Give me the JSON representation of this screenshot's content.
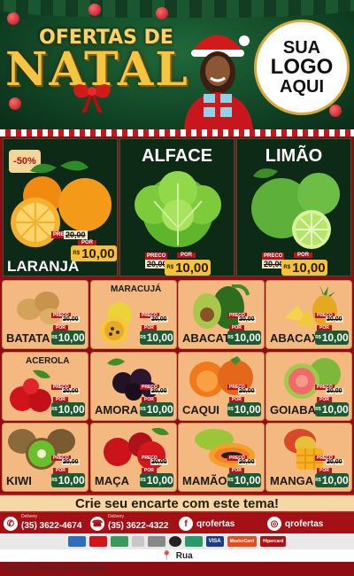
{
  "header": {
    "title_top": "OFERTAS DE",
    "title_main": "NATAL",
    "logo_line1": "SUA",
    "logo_line2": "LOGO",
    "logo_line3": "AQUI"
  },
  "featured": [
    {
      "name": "LARANJA",
      "badge": "-50%",
      "preco_label": "PRECO",
      "old_price": "20,00",
      "por_label": "POR",
      "currency": "R$",
      "new_price": "10,00"
    },
    {
      "name": "ALFACE",
      "preco_label": "PRECO",
      "old_price": "20,00",
      "por_label": "POR",
      "currency": "R$",
      "new_price": "10,00"
    },
    {
      "name": "LIMÃO",
      "preco_label": "PRECO",
      "old_price": "20,00",
      "por_label": "POR",
      "currency": "R$",
      "new_price": "10,00"
    }
  ],
  "products": [
    {
      "name": "BATATA",
      "old_price": "20,00",
      "new_price": "10,00"
    },
    {
      "name": "MARACUJÁ",
      "old_price": "20,00",
      "new_price": "10,00"
    },
    {
      "name": "ABACATE",
      "old_price": "20,00",
      "new_price": "10,00"
    },
    {
      "name": "ABACAXI",
      "old_price": "20,00",
      "new_price": "10,00"
    },
    {
      "name": "ACEROLA",
      "old_price": "20,00",
      "new_price": "10,00"
    },
    {
      "name": "AMORA",
      "old_price": "20,00",
      "new_price": "10,00"
    },
    {
      "name": "CAQUI",
      "old_price": "20,00",
      "new_price": "10,00"
    },
    {
      "name": "GOIABA",
      "old_price": "20,00",
      "new_price": "10,00"
    },
    {
      "name": "KIWI",
      "old_price": "20,00",
      "new_price": "10,00"
    },
    {
      "name": "MAÇA",
      "old_price": "20,00",
      "new_price": "10,00"
    },
    {
      "name": "MAMÃO",
      "old_price": "20,00",
      "new_price": "10,00"
    },
    {
      "name": "MANGA",
      "old_price": "20,00",
      "new_price": "10,00"
    }
  ],
  "price_labels": {
    "preco": "PRECO",
    "por": "POR",
    "currency": "R$"
  },
  "footer": {
    "banner": "Crie seu encarte com este tema!",
    "delivery1_label": "Delivery",
    "delivery1_phone": "(35) 3622-4674",
    "delivery2_label": "Delivery",
    "delivery2_phone": "(35) 3622-4322",
    "facebook": "qrofertas",
    "instagram": "qrofertas",
    "payments": [
      "VISA",
      "MasterCard",
      "Hipercard"
    ],
    "address": "Rua",
    "disclaimer": "*Imagens Meramente Ilustrativas"
  },
  "colors": {
    "header_green": "#1f6a3a",
    "brand_red": "#a31016",
    "gold": "#f4c542",
    "price_green": "#1c5a2f",
    "card_peach": "#f4b980"
  }
}
